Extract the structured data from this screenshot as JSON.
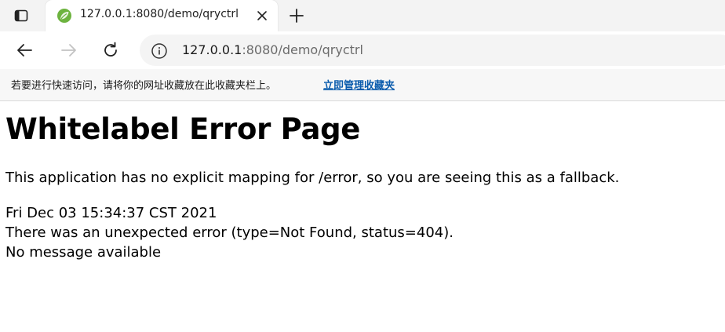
{
  "browser": {
    "tab": {
      "title": "127.0.0.1:8080/demo/qryctrl",
      "favicon": "spring-leaf-icon",
      "close_icon": "close-icon"
    },
    "new_tab_icon": "plus-icon",
    "tabs_menu_icon": "tab-actions-icon",
    "nav": {
      "back_icon": "back-arrow-icon",
      "forward_icon": "forward-arrow-icon",
      "reload_icon": "reload-icon"
    },
    "address": {
      "info_icon": "info-icon",
      "url_host": "127.0.0.1",
      "url_rest": ":8080/demo/qryctrl"
    },
    "bookmarks_bar": {
      "message": "若要进行快速访问，请将你的网址收藏放在此收藏夹栏上。",
      "link": "立即管理收藏夹",
      "link_color": "#0b5cad"
    }
  },
  "page": {
    "title": "Whitelabel Error Page",
    "description": "This application has no explicit mapping for /error, so you are seeing this as a fallback.",
    "timestamp": "Fri Dec 03 15:34:37 CST 2021",
    "error_line": "There was an unexpected error (type=Not Found, status=404).",
    "message_line": "No message available"
  }
}
